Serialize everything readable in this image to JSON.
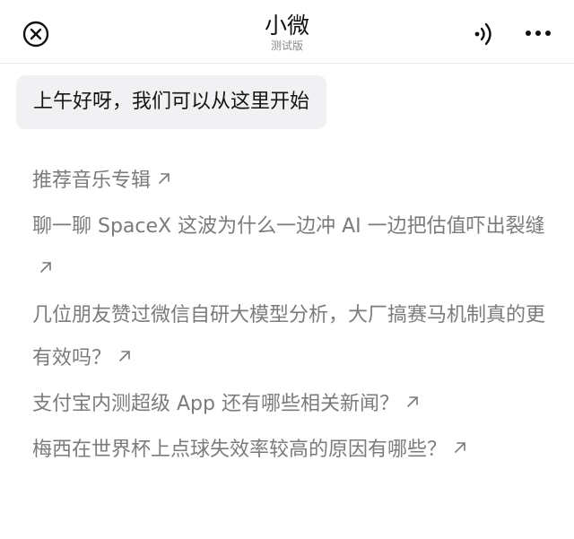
{
  "header": {
    "title": "小微",
    "subtitle": "测试版",
    "close_icon": "close-circle-icon",
    "voice_icon": "voice-icon",
    "more_icon": "more-horizontal-icon"
  },
  "greeting": {
    "text": "上午好呀，我们可以从这里开始"
  },
  "suggestions": [
    {
      "text": "推荐音乐专辑"
    },
    {
      "text": "聊一聊 SpaceX 这波为什么一边冲 AI 一边把估值吓出裂缝"
    },
    {
      "text": "几位朋友赞过微信自研大模型分析，大厂搞赛马机制真的更有效吗？"
    },
    {
      "text": "支付宝内测超级 App 还有哪些相关新闻？"
    },
    {
      "text": "梅西在世界杯上点球失效率较高的原因有哪些？"
    }
  ],
  "colors": {
    "bubble_bg": "#f1f1f3",
    "suggestion_text": "#7b7b7b",
    "title_text": "#111111"
  }
}
